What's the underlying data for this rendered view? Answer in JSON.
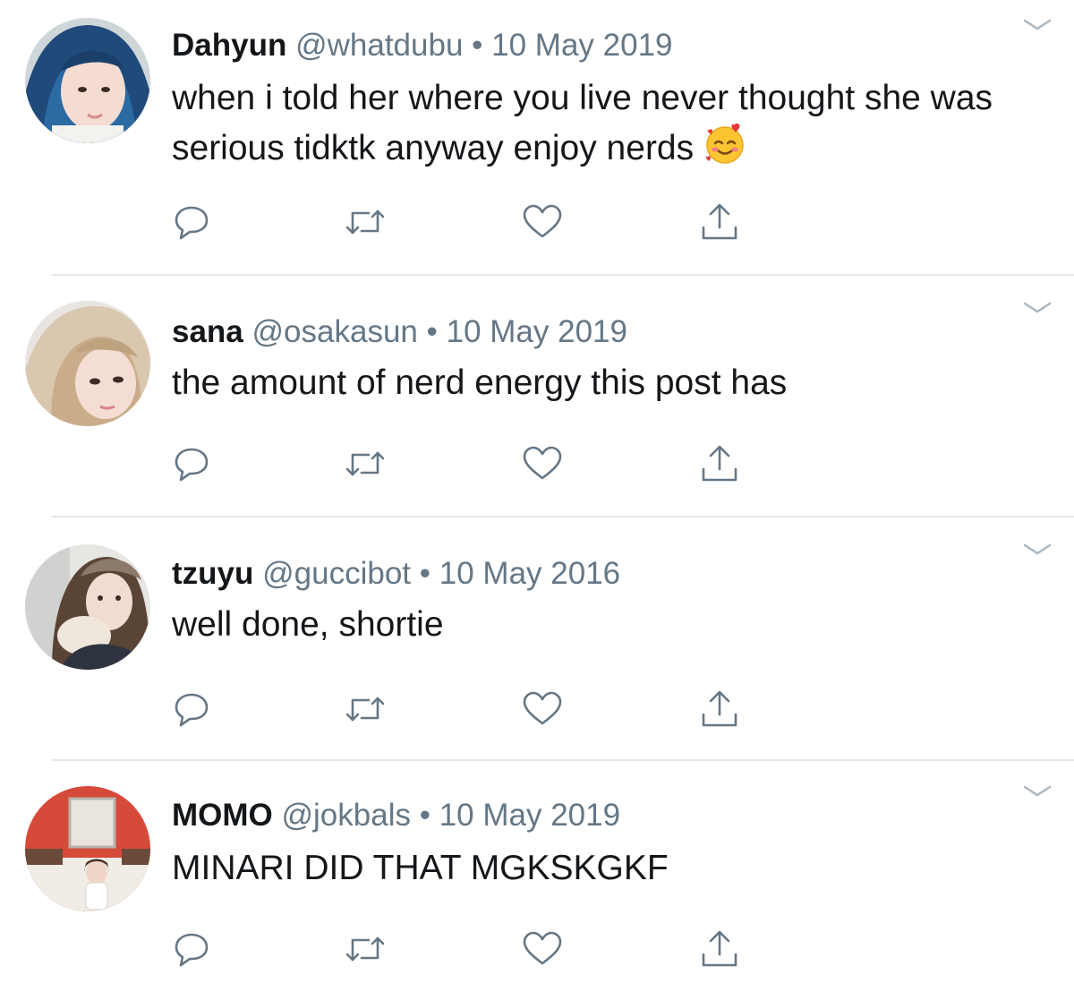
{
  "icons": {
    "reply": "speech-bubble-icon",
    "retweet": "retweet-arrows-icon",
    "like": "heart-icon",
    "share": "share-upload-icon",
    "menu": "chevron-down-icon"
  },
  "colors": {
    "text": "#14171a",
    "meta": "#657786",
    "icon": "#657786",
    "divider": "#e1e8ed"
  },
  "tweets": [
    {
      "name": "Dahyun",
      "handle": "@whatdubu",
      "separator": "•",
      "date": "10 May 2019",
      "text": "when i told her where you live never thought she was serious tidktk anyway enjoy nerds",
      "emoji": "smiling-face-with-hearts"
    },
    {
      "name": "sana",
      "handle": "@osakasun",
      "separator": "•",
      "date": "10 May 2019",
      "text": "the amount of nerd energy this post has"
    },
    {
      "name": "tzuyu",
      "handle": "@guccibot",
      "separator": "•",
      "date": "10 May 2016",
      "text": "well done, shortie"
    },
    {
      "name": "MOMO",
      "handle": "@jokbals",
      "separator": "•",
      "date": "10 May 2019",
      "text": "MINARI DID THAT MGKSKGKF"
    }
  ]
}
